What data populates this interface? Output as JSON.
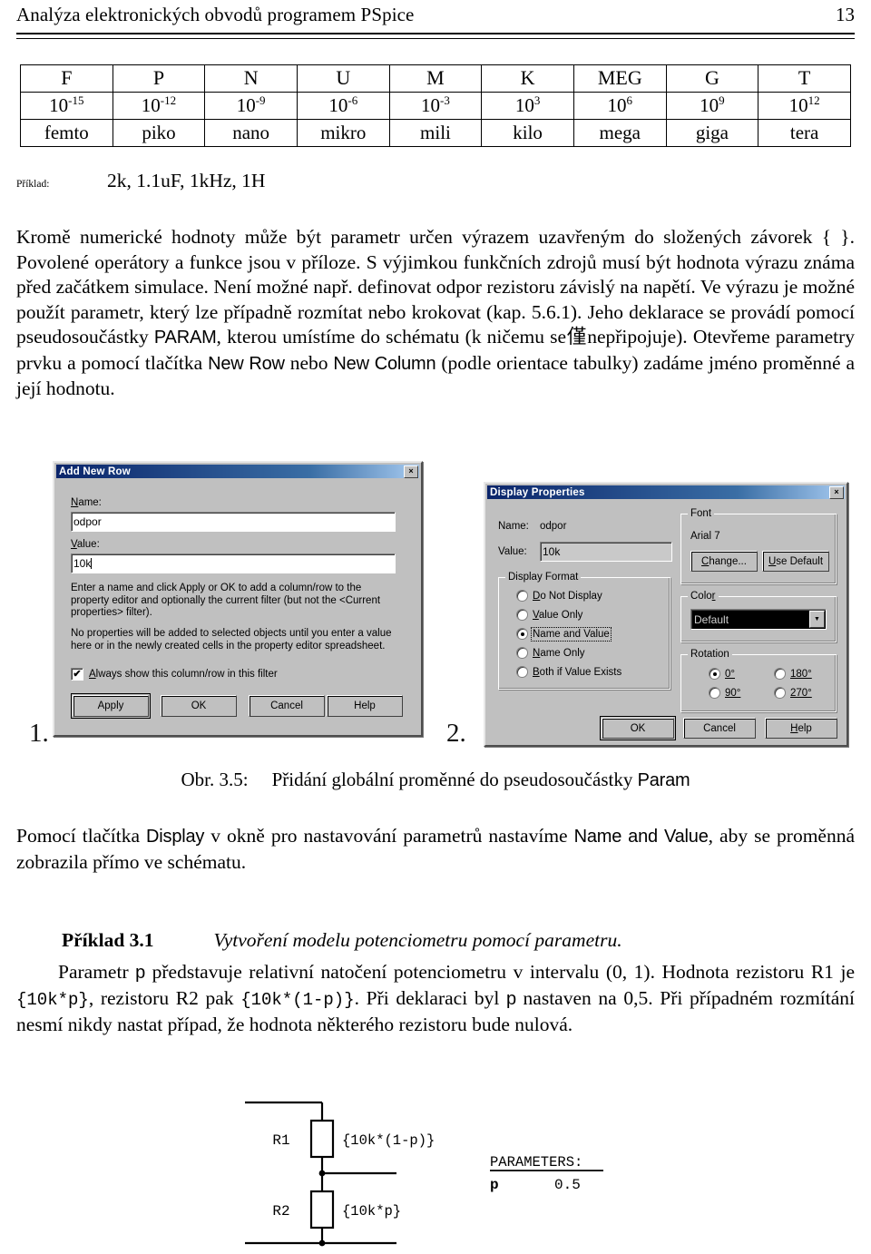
{
  "header": {
    "title": "Analýza elektronických obvodů programem PSpice",
    "page_number": "13"
  },
  "prefix_table": {
    "symbols": [
      "F",
      "P",
      "N",
      "U",
      "M",
      "K",
      "MEG",
      "G",
      "T"
    ],
    "powers_base": [
      "10",
      "10",
      "10",
      "10",
      "10",
      "10",
      "10",
      "10",
      "10"
    ],
    "powers_exp": [
      "-15",
      "-12",
      "-9",
      "-6",
      "-3",
      "3",
      "6",
      "9",
      "12"
    ],
    "names": [
      "femto",
      "piko",
      "nano",
      "mikro",
      "mili",
      "kilo",
      "mega",
      "giga",
      "tera"
    ]
  },
  "example_line": {
    "label": "Příklad:",
    "value": "2k, 1.1uF, 1kHz, 1H"
  },
  "paragraph1": {
    "part1": "Kromě numerické hodnoty může být parametr určen výrazem uzavřeným do složených závorek { }. Povolené operátory a funkce jsou v příloze. S výjimkou funkčních zdrojů musí být hodnota výrazu známa před začátkem simulace. Není možné např. definovat odpor rezistoru závislý na napětí. Ve výrazu je možné použít parametr, který lze případně rozmítat nebo krokovat (kap. 5.6.1). Jeho deklarace se provádí pomocí pseudosoučástky ",
    "param_kw": "PARAM",
    "part2": ", kterou umístíme do schématu (k ničemu se僅nepřipojuje). Otevřeme parametry prvku a pomocí tlačítka ",
    "newrow_kw": "New Row",
    "part3": " nebo ",
    "newcol_kw": "New Column",
    "part4": " (podle orientace tabulky) zadáme jméno proměnné a její hodnotu."
  },
  "dialog_add_new_row": {
    "title": "Add New Row",
    "close_label": "×",
    "name_label": "Name:",
    "name_label_mnemonic": "N",
    "name_value": "odpor",
    "value_label": "Value:",
    "value_label_mnemonic": "V",
    "value_value": "10k",
    "help_text_1": "Enter a name and click Apply or OK to add a column/row to the property editor and optionally the current filter (but not the <Current properties> filter).",
    "help_text_2": "No properties will be added to selected objects until you enter a value here or in the newly created cells in the property editor spreadsheet.",
    "checkbox_label": "Always show this column/row in this filter",
    "checkbox_mnemonic": "A",
    "checkbox_checked": true,
    "check_glyph": "✔",
    "buttons": [
      "Apply",
      "OK",
      "Cancel",
      "Help"
    ],
    "default_button": "Apply"
  },
  "dialog_display_properties": {
    "title": "Display Properties",
    "close_label": "×",
    "name_label": "Name:",
    "name_value": "odpor",
    "value_label": "Value:",
    "value_value": "10k",
    "display_format": {
      "group_label": "Display Format",
      "options": [
        "Do Not Display",
        "Value Only",
        "Name and Value",
        "Name Only",
        "Both if Value Exists"
      ],
      "mnemonics": [
        "D",
        "V",
        "N",
        "N",
        "B"
      ],
      "selected": "Name and Value"
    },
    "font": {
      "group_label": "Font",
      "current": "Arial 7",
      "change_button": "Change...",
      "change_mnemonic": "C",
      "use_default_button": "Use Default",
      "use_default_mnemonic": "U"
    },
    "color": {
      "group_label": "Color",
      "selected": "Default",
      "arrow": "▼"
    },
    "rotation": {
      "group_label": "Rotation",
      "options": [
        "0°",
        "90°",
        "180°",
        "270°"
      ],
      "selected": "0°"
    },
    "buttons": [
      "OK",
      "Cancel",
      "Help"
    ],
    "default_button": "OK"
  },
  "figure": {
    "number_1": "1.",
    "number_2": "2.",
    "caption_label": "Obr. 3.5:",
    "caption_text": "Přidání globální proměnné do pseudosoučástky ",
    "caption_kw": "Param"
  },
  "paragraph2": {
    "part1": "Pomocí tlačítka ",
    "display_kw": "Display",
    "part2": " v okně pro nastavování parametrů nastavíme ",
    "nv_kw": "Name and Value",
    "part3": ", aby se proměnná zobrazila přímo ve schématu."
  },
  "example_heading": {
    "label": "Příklad 3.1",
    "text": "Vytvoření modelu potenciometru pomocí parametru."
  },
  "paragraph3": {
    "part1": "Parametr ",
    "p_kw": "p",
    "part2": " představuje relativní natočení potenciometru v intervalu (0, 1). Hodnota rezistoru R1 je ",
    "r1_expr": "{10k*p}",
    "part3": ", rezistoru R2 pak ",
    "r2_expr": "{10k*(1-p)}",
    "part4": ". Při deklaraci byl ",
    "p_kw2": "p",
    "part5": " nastaven na 0,5. Při případném rozmítání nesmí nikdy nastat případ, že hodnota některého rezistoru bude nulová."
  },
  "schematic": {
    "r1_label": "R1",
    "r1_value": "{10k*(1-p)}",
    "r2_label": "R2",
    "r2_value": "{10k*p}",
    "params_title": "PARAMETERS:",
    "param_name": "p",
    "param_value": "0.5"
  }
}
